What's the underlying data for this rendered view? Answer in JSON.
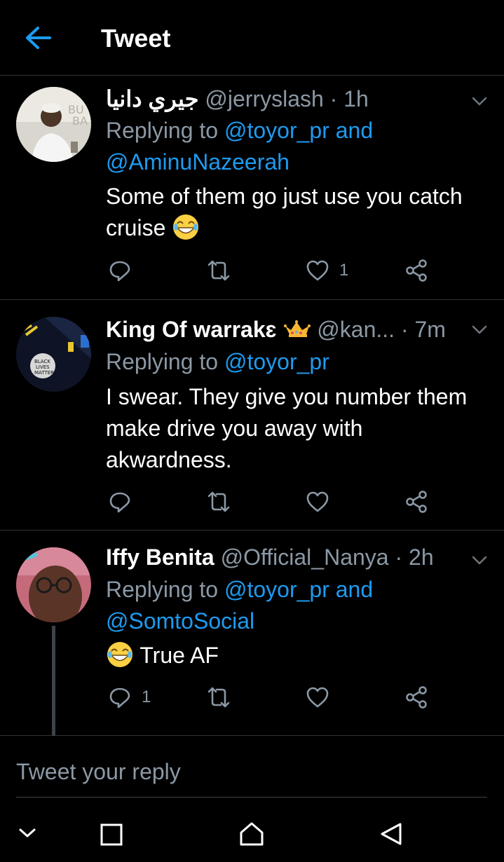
{
  "header": {
    "title": "Tweet"
  },
  "tweets": [
    {
      "name": "جيري دانيا",
      "handle": "@jerryslash",
      "separator": "·",
      "time": "1h",
      "replying_prefix": "Replying to",
      "reply_mentions": [
        "@toyor_pr and",
        "@AminuNazeerah"
      ],
      "text": "Some of them go just use you catch cruise",
      "emoji": "grinning-tears",
      "reply_count": "",
      "like_count": "1"
    },
    {
      "name": "King Of warrakɛ",
      "badge": "crown",
      "handle": "@kan...",
      "separator": "·",
      "time": "7m",
      "replying_prefix": "Replying to",
      "reply_mentions": [
        "@toyor_pr"
      ],
      "text": "I swear. They give you number them make drive you away with akwardness.",
      "reply_count": "",
      "like_count": ""
    },
    {
      "name": "Iffy Benita",
      "handle": "@Official_Nanya",
      "separator": "·",
      "time": "2h",
      "replying_prefix": "Replying to",
      "reply_mentions": [
        "@toyor_pr and",
        "@SomtoSocial"
      ],
      "text": "True AF",
      "emoji": "grinning-tears",
      "reply_count": "1",
      "like_count": ""
    }
  ],
  "reply_box": {
    "placeholder": "Tweet your reply"
  },
  "colors": {
    "accent": "#1d9bf0",
    "muted": "#8b98a5",
    "divider": "#2f3336",
    "background": "#000000"
  },
  "icons": [
    "back-arrow-icon",
    "chevron-down-icon",
    "reply-icon",
    "retweet-icon",
    "like-icon",
    "share-icon",
    "crown-icon",
    "emoji-icon",
    "nav-collapse-icon",
    "nav-square-icon",
    "nav-home-icon",
    "nav-back-icon"
  ]
}
